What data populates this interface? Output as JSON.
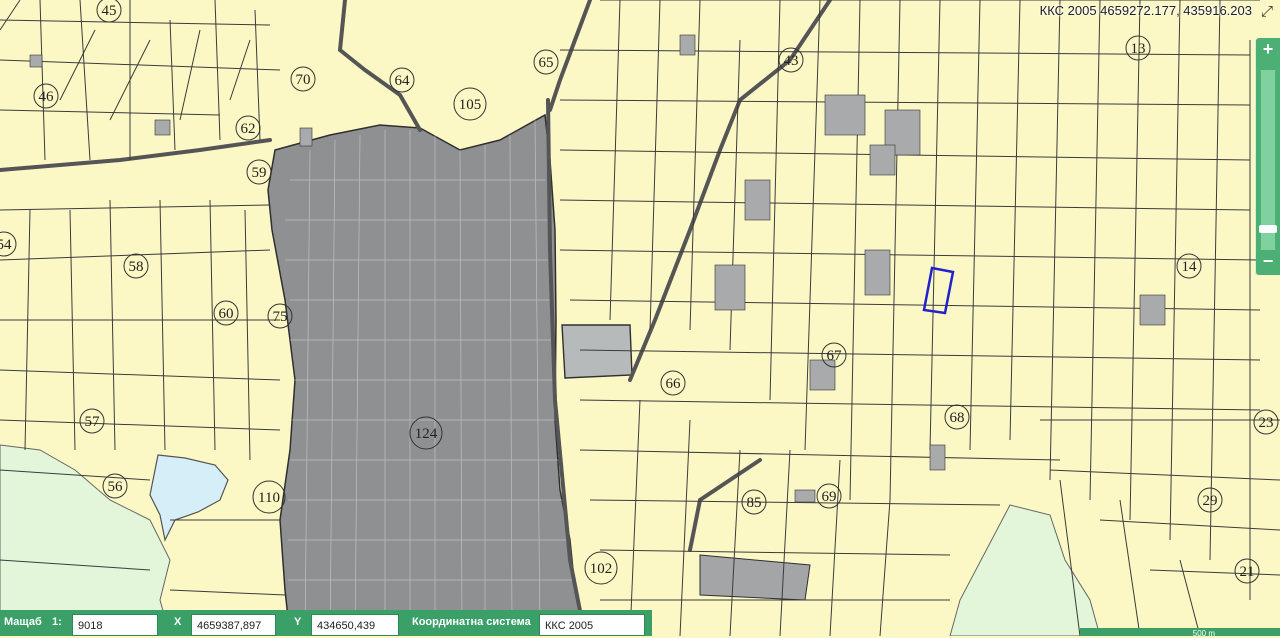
{
  "map": {
    "parcel_numbers": [
      {
        "label": "45"
      },
      {
        "label": "46"
      },
      {
        "label": "70"
      },
      {
        "label": "64"
      },
      {
        "label": "65"
      },
      {
        "label": "105"
      },
      {
        "label": "43"
      },
      {
        "label": "13"
      },
      {
        "label": "62"
      },
      {
        "label": "59"
      },
      {
        "label": "58"
      },
      {
        "label": "54"
      },
      {
        "label": "60"
      },
      {
        "label": "75"
      },
      {
        "label": "14"
      },
      {
        "label": "67"
      },
      {
        "label": "66"
      },
      {
        "label": "68"
      },
      {
        "label": "57"
      },
      {
        "label": "124"
      },
      {
        "label": "23"
      },
      {
        "label": "56"
      },
      {
        "label": "110"
      },
      {
        "label": "85"
      },
      {
        "label": "69"
      },
      {
        "label": "29"
      },
      {
        "label": "102"
      },
      {
        "label": "21"
      }
    ],
    "colors": {
      "parcel_fill": "#fbf8c6",
      "parcel_line": "#3b3b3b",
      "urban_area": "#8f9092",
      "forest": "#e3f6d9",
      "water": "#d6eef8",
      "selection": "#2222cc",
      "panel": "#3aa067"
    }
  },
  "coord_readout": "ККС 2005 4659272.177, 435916.203",
  "zoom": {
    "in_label": "+",
    "out_label": "−",
    "level": 0.1
  },
  "fullscreen_icon": "expand-icon",
  "status_bar": {
    "scale_label": "Мащаб",
    "scale_prefix": "1:",
    "scale_value": "9018",
    "x_label": "X",
    "x_value": "4659387,897",
    "y_label": "Y",
    "y_value": "434650,439",
    "crs_label": "Координатна система",
    "crs_value": "ККС 2005"
  },
  "scale_bar_text": "500 m"
}
